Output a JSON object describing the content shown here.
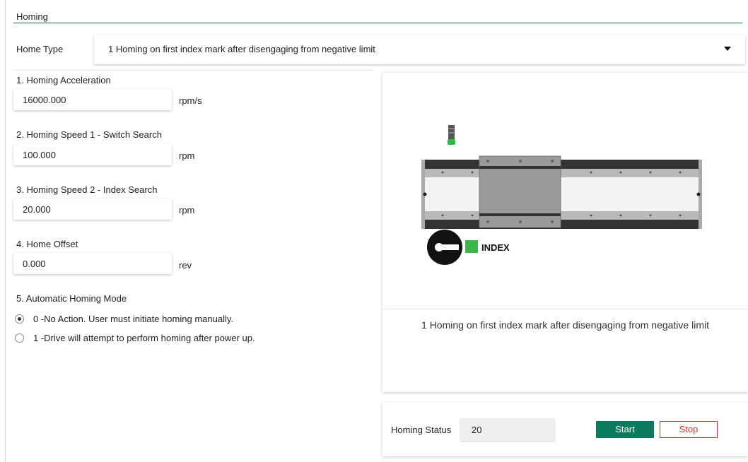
{
  "section": {
    "title": "Homing"
  },
  "home_type": {
    "label": "Home Type",
    "value": "1 Homing on first index mark after disengaging from negative limit"
  },
  "fields": [
    {
      "label": "1. Homing Acceleration",
      "value": "16000.000",
      "unit": "rpm/s"
    },
    {
      "label": "2. Homing Speed 1 - Switch Search",
      "value": "100.000",
      "unit": "rpm"
    },
    {
      "label": "3. Homing Speed 2 - Index Search",
      "value": "20.000",
      "unit": "rpm"
    },
    {
      "label": "4. Home Offset",
      "value": "0.000",
      "unit": "rev"
    }
  ],
  "auto_mode": {
    "label": "5. Automatic Homing Mode",
    "options": [
      {
        "label": "0 -No Action. User must initiate homing manually.",
        "selected": true
      },
      {
        "label": "1 -Drive will attempt to perform homing after power up.",
        "selected": false
      }
    ]
  },
  "illustration": {
    "index_label": "INDEX",
    "caption": "1 Homing on first index mark after disengaging from negative limit"
  },
  "status": {
    "label": "Homing Status",
    "value": "20",
    "start_label": "Start",
    "stop_label": "Stop",
    "accent": "#0c7a5c",
    "stop_color": "#d32f2f"
  }
}
